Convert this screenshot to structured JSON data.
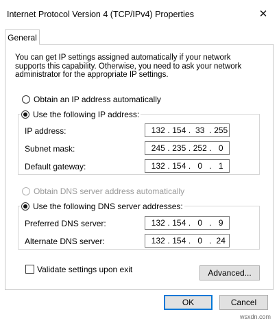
{
  "window": {
    "title": "Internet Protocol Version 4 (TCP/IPv4) Properties",
    "close_glyph": "✕"
  },
  "tabs": [
    {
      "label": "General"
    }
  ],
  "description": "You can get IP settings assigned automatically if your network supports this capability. Otherwise, you need to ask your network administrator for the appropriate IP settings.",
  "ip_section": {
    "auto_label": "Obtain an IP address automatically",
    "manual_label": "Use the following IP address:",
    "auto_selected": false,
    "fields": [
      {
        "label": "IP address:",
        "octets": [
          "132",
          "154",
          "33",
          "255"
        ]
      },
      {
        "label": "Subnet mask:",
        "octets": [
          "245",
          "235",
          "252",
          "0"
        ]
      },
      {
        "label": "Default gateway:",
        "octets": [
          "132",
          "154",
          "0",
          "1"
        ]
      }
    ]
  },
  "dns_section": {
    "auto_label": "Obtain DNS server address automatically",
    "manual_label": "Use the following DNS server addresses:",
    "auto_disabled": true,
    "fields": [
      {
        "label": "Preferred DNS server:",
        "octets": [
          "132",
          "154",
          "0",
          "9"
        ]
      },
      {
        "label": "Alternate DNS server:",
        "octets": [
          "132",
          "154",
          "0",
          "24"
        ]
      }
    ]
  },
  "validate_label": "Validate settings upon exit",
  "validate_checked": false,
  "buttons": {
    "advanced": "Advanced...",
    "ok": "OK",
    "cancel": "Cancel"
  },
  "watermark": "wsxdn.com",
  "colors": {
    "default_button_border": "#0078d7",
    "button_face": "#e1e1e1"
  }
}
